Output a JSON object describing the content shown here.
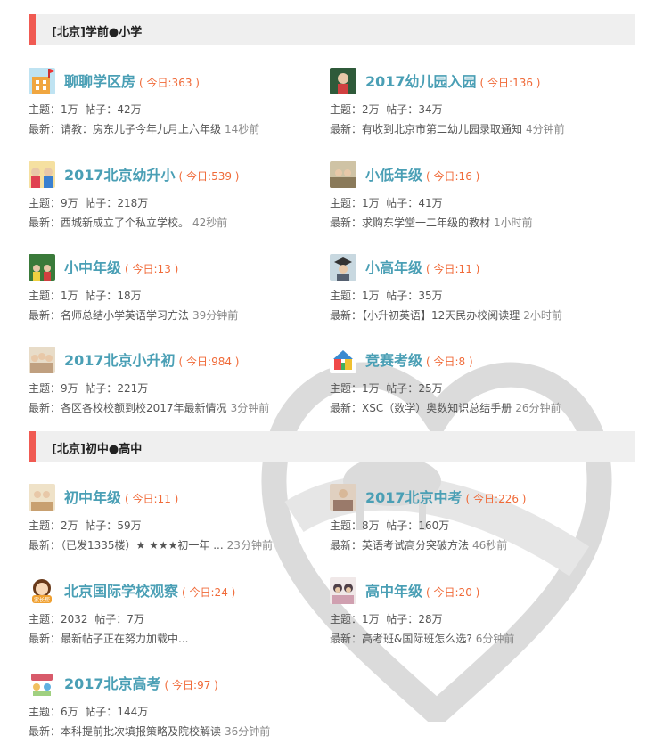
{
  "sections": [
    {
      "title": "[北京]学前●小学",
      "forums": [
        {
          "name": "聊聊学区房",
          "today": "( 今日:363 )",
          "topics_label": "主题：",
          "topics": "1万",
          "posts_label": "帖子：",
          "posts": "42万",
          "latest_label": "最新：",
          "latest": "请教：房东儿子今年九月上六年级",
          "ago": "14秒前",
          "icon": "building-icon",
          "icon_color": "#f0a640"
        },
        {
          "name": "2017幼儿园入园",
          "today": "( 今日:136 )",
          "topics_label": "主题：",
          "topics": "2万",
          "posts_label": "帖子：",
          "posts": "34万",
          "latest_label": "最新：",
          "latest": "有收到北京市第二幼儿园录取通知",
          "ago": "4分钟前",
          "icon": "child-photo-icon",
          "icon_color": "#2f5a3a"
        },
        {
          "name": "2017北京幼升小",
          "today": "( 今日:539 )",
          "topics_label": "主题：",
          "topics": "9万",
          "posts_label": "帖子：",
          "posts": "218万",
          "latest_label": "最新：",
          "latest": "西城新成立了个私立学校。",
          "ago": "42秒前",
          "icon": "kids-photo-icon",
          "icon_color": "#e8c040"
        },
        {
          "name": "小低年级",
          "today": "( 今日:16 )",
          "topics_label": "主题：",
          "topics": "1万",
          "posts_label": "帖子：",
          "posts": "41万",
          "latest_label": "最新：",
          "latest": "求购东学堂一二年级的教材",
          "ago": "1小时前",
          "icon": "classroom-photo-icon",
          "icon_color": "#8a7a5a"
        },
        {
          "name": "小中年级",
          "today": "( 今日:13 )",
          "topics_label": "主题：",
          "topics": "1万",
          "posts_label": "帖子：",
          "posts": "18万",
          "latest_label": "最新：",
          "latest": "名师总结小学英语学习方法",
          "ago": "39分钟前",
          "icon": "blackboard-photo-icon",
          "icon_color": "#3a7a3a"
        },
        {
          "name": "小高年级",
          "today": "( 今日:11 )",
          "topics_label": "主题：",
          "topics": "1万",
          "posts_label": "帖子：",
          "posts": "35万",
          "latest_label": "最新：",
          "latest": "【小升初英语】12天民办校阅读理",
          "ago": "2小时前",
          "icon": "graduate-photo-icon",
          "icon_color": "#556070"
        },
        {
          "name": "2017北京小升初",
          "today": "( 今日:984 )",
          "topics_label": "主题：",
          "topics": "9万",
          "posts_label": "帖子：",
          "posts": "221万",
          "latest_label": "最新：",
          "latest": "各区各校校额到校2017年最新情况",
          "ago": "3分钟前",
          "icon": "students-photo-icon",
          "icon_color": "#c0a080"
        },
        {
          "name": "竞赛考级",
          "today": "( 今日:8 )",
          "topics_label": "主题：",
          "topics": "1万",
          "posts_label": "帖子：",
          "posts": "25万",
          "latest_label": "最新：",
          "latest": "XSC（数学）奥数知识总结手册",
          "ago": "26分钟前",
          "icon": "colorful-house-icon",
          "icon_color": "#3a8ad0"
        }
      ]
    },
    {
      "title": "[北京]初中●高中",
      "forums": [
        {
          "name": "初中年级",
          "today": "( 今日:11 )",
          "topics_label": "主题：",
          "topics": "2万",
          "posts_label": "帖子：",
          "posts": "59万",
          "latest_label": "最新：",
          "latest": "（已发1335楼）★ ★★★初一年 ...",
          "ago": "23分钟前",
          "icon": "study-photo-icon",
          "icon_color": "#c8a070"
        },
        {
          "name": "2017北京中考",
          "today": "( 今日:226 )",
          "topics_label": "主题：",
          "topics": "8万",
          "posts_label": "帖子：",
          "posts": "160万",
          "latest_label": "最新：",
          "latest": "英语考试高分突破方法",
          "ago": "46秒前",
          "icon": "exam-photo-icon",
          "icon_color": "#9a7a6a"
        },
        {
          "name": "北京国际学校观察",
          "today": "( 今日:24 )",
          "topics_label": "主题：",
          "topics": "2032",
          "posts_label": "帖子：",
          "posts": "7万",
          "latest_label": "最新：",
          "latest": "最新帖子正在努力加载中...",
          "ago": "",
          "icon": "cartoon-girl-icon",
          "icon_color": "#f0a030",
          "icon_text": "家长帮"
        },
        {
          "name": "高中年级",
          "today": "( 今日:20 )",
          "topics_label": "主题：",
          "topics": "1万",
          "posts_label": "帖子：",
          "posts": "28万",
          "latest_label": "最新：",
          "latest": "高考班&国际班怎么选?",
          "ago": "6分钟前",
          "icon": "teens-photo-icon",
          "icon_color": "#504048"
        },
        {
          "name": "2017北京高考",
          "today": "( 今日:97 )",
          "topics_label": "主题：",
          "topics": "6万",
          "posts_label": "帖子：",
          "posts": "144万",
          "latest_label": "最新：",
          "latest": "本科提前批次填报策略及院校解读",
          "ago": "36分钟前",
          "icon": "exam-cartoon-icon",
          "icon_color": "#d85a6a"
        }
      ]
    }
  ]
}
